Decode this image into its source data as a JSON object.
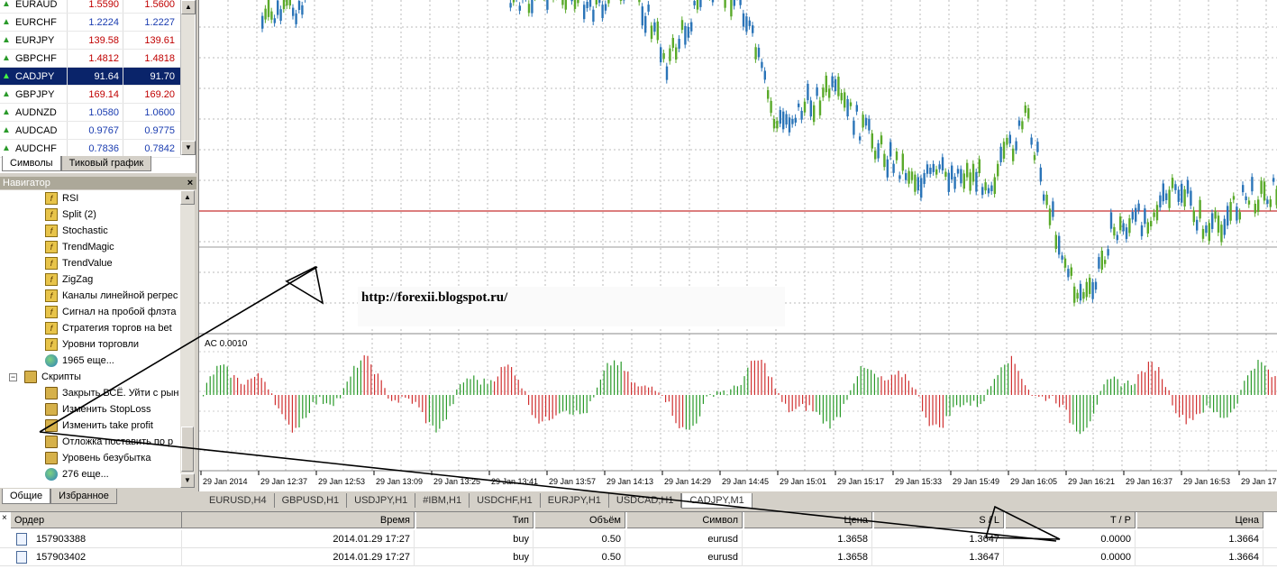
{
  "market_watch": {
    "rows": [
      {
        "symbol": "EURAUD",
        "bid": "1.5590",
        "ask": "1.5600",
        "color": "red"
      },
      {
        "symbol": "EURCHF",
        "bid": "1.2224",
        "ask": "1.2227",
        "color": "blue"
      },
      {
        "symbol": "EURJPY",
        "bid": "139.58",
        "ask": "139.61",
        "color": "red"
      },
      {
        "symbol": "GBPCHF",
        "bid": "1.4812",
        "ask": "1.4818",
        "color": "red"
      },
      {
        "symbol": "CADJPY",
        "bid": "91.64",
        "ask": "91.70",
        "color": "selected"
      },
      {
        "symbol": "GBPJPY",
        "bid": "169.14",
        "ask": "169.20",
        "color": "red"
      },
      {
        "symbol": "AUDNZD",
        "bid": "1.0580",
        "ask": "1.0600",
        "color": "blue"
      },
      {
        "symbol": "AUDCAD",
        "bid": "0.9767",
        "ask": "0.9775",
        "color": "blue"
      },
      {
        "symbol": "AUDCHF",
        "bid": "0.7836",
        "ask": "0.7842",
        "color": "blue"
      }
    ],
    "tabs": [
      "Символы",
      "Тиковый график"
    ]
  },
  "navigator": {
    "title": "Навигатор",
    "close": "×",
    "items": [
      {
        "label": "RSI",
        "icon": "indicator-icon"
      },
      {
        "label": "Split (2)",
        "icon": "indicator-icon"
      },
      {
        "label": "Stochastic",
        "icon": "indicator-icon"
      },
      {
        "label": "TrendMagic",
        "icon": "indicator-icon"
      },
      {
        "label": "TrendValue",
        "icon": "indicator-icon"
      },
      {
        "label": "ZigZag",
        "icon": "indicator-icon"
      },
      {
        "label": "Каналы линейной регрес",
        "icon": "indicator-icon"
      },
      {
        "label": "Сигнал на пробой флэта",
        "icon": "indicator-icon"
      },
      {
        "label": "Стратегия торгов на bet",
        "icon": "indicator-icon"
      },
      {
        "label": "Уровни торговли",
        "icon": "indicator-icon"
      },
      {
        "label": "1965 еще...",
        "icon": "globe-icon"
      }
    ],
    "scripts_label": "Скрипты",
    "scripts": [
      {
        "label": "Закрыть ВСЁ. Уйти с рын",
        "icon": "script-icon"
      },
      {
        "label": "Изменить StopLoss",
        "icon": "script-icon"
      },
      {
        "label": "Изменить take profit",
        "icon": "script-icon"
      },
      {
        "label": "Отложка поставить по р",
        "icon": "script-icon"
      },
      {
        "label": "Уровень безубытка",
        "icon": "script-icon"
      },
      {
        "label": "276 еще...",
        "icon": "globe-icon"
      }
    ],
    "tabs": [
      "Общие",
      "Избранное"
    ]
  },
  "chart": {
    "watermark": "http://forexii.blogspot.ru/",
    "indicator_label": "AC 0.0010",
    "time_labels": [
      "29 Jan 2014",
      "29 Jan 12:37",
      "29 Jan 12:53",
      "29 Jan 13:09",
      "29 Jan 13:25",
      "29 Jan 13:41",
      "29 Jan 13:57",
      "29 Jan 14:13",
      "29 Jan 14:29",
      "29 Jan 14:45",
      "29 Jan 15:01",
      "29 Jan 15:17",
      "29 Jan 15:33",
      "29 Jan 15:49",
      "29 Jan 16:05",
      "29 Jan 16:21",
      "29 Jan 16:37",
      "29 Jan 16:53",
      "29 Jan 17:"
    ],
    "colors": {
      "bull": "#5aaa2a",
      "bear": "#2a74b8",
      "level": "#c83030",
      "ac_up": "#2a9a2a",
      "ac_down": "#d03030"
    }
  },
  "chart_tabs": [
    "EURUSD,H4",
    "GBPUSD,H1",
    "USDJPY,H1",
    "#IBM,H1",
    "USDCHF,H1",
    "EURJPY,H1",
    "USDCAD,H1",
    "CADJPY,M1"
  ],
  "terminal": {
    "close": "×",
    "columns": [
      "Ордер",
      "Время",
      "Тип",
      "Объём",
      "Символ",
      "Цена",
      "S / L",
      "T / P",
      "Цена"
    ],
    "rows": [
      [
        "157903388",
        "2014.01.29 17:27",
        "buy",
        "0.50",
        "eurusd",
        "1.3658",
        "1.3647",
        "0.0000",
        "1.3664"
      ],
      [
        "157903402",
        "2014.01.29 17:27",
        "buy",
        "0.50",
        "eurusd",
        "1.3658",
        "1.3647",
        "0.0000",
        "1.3664"
      ]
    ]
  }
}
